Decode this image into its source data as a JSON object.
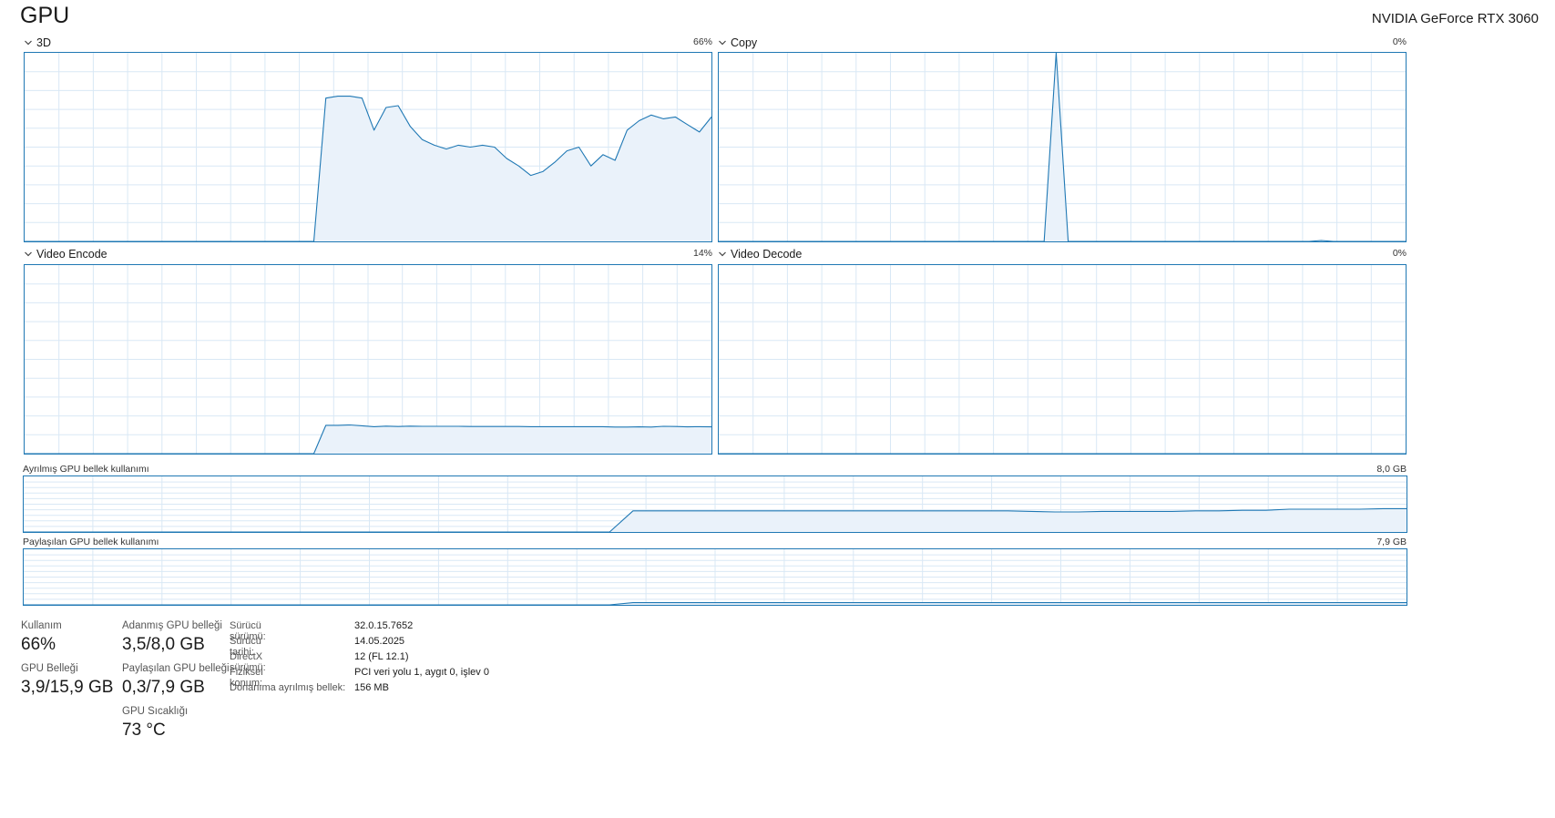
{
  "header": {
    "title": "GPU",
    "device_name": "NVIDIA GeForce RTX 3060"
  },
  "engines": [
    {
      "label": "3D",
      "max_label": "66%",
      "values": [
        0,
        0,
        0,
        0,
        0,
        0,
        0,
        0,
        0,
        0,
        0,
        0,
        0,
        0,
        0,
        0,
        0,
        0,
        0,
        0,
        0,
        0,
        0,
        0,
        0,
        76,
        77,
        77,
        76,
        59,
        71,
        72,
        61,
        54,
        51,
        49,
        51,
        50,
        51,
        50,
        44,
        40,
        35,
        37,
        42,
        48,
        50,
        40,
        46,
        43,
        59,
        64,
        67,
        65,
        66,
        62,
        58,
        66
      ],
      "color": "#1f78b4"
    },
    {
      "label": "Copy",
      "max_label": "0%",
      "values": [
        0,
        0,
        0,
        0,
        0,
        0,
        0,
        0,
        0,
        0,
        0,
        0,
        0,
        0,
        0,
        0,
        0,
        0,
        0,
        0,
        0,
        0,
        0,
        0,
        0,
        0,
        0,
        0,
        100,
        0,
        0,
        0,
        0,
        0,
        0,
        0,
        0,
        0,
        0,
        0,
        0,
        0,
        0,
        0,
        0,
        0,
        0,
        0,
        0,
        0,
        0.5,
        0,
        0,
        0,
        0,
        0,
        0,
        0
      ]
    },
    {
      "label": "Video Encode",
      "max_label": "14%",
      "values": [
        0,
        0,
        0,
        0,
        0,
        0,
        0,
        0,
        0,
        0,
        0,
        0,
        0,
        0,
        0,
        0,
        0,
        0,
        0,
        0,
        0,
        0,
        0,
        0,
        0,
        15,
        15,
        15.2,
        14.8,
        14.3,
        14.6,
        14.4,
        14.6,
        14.5,
        14.5,
        14.5,
        14.5,
        14.4,
        14.4,
        14.4,
        14.4,
        14.4,
        14.3,
        14.3,
        14.3,
        14.3,
        14.3,
        14.3,
        14.3,
        14.1,
        14.1,
        14.2,
        14.1,
        14.5,
        14.4,
        14.2,
        14.3,
        14.2
      ]
    },
    {
      "label": "Video Decode",
      "max_label": "0%",
      "values": [
        0,
        0,
        0,
        0,
        0,
        0,
        0,
        0,
        0,
        0,
        0,
        0,
        0,
        0,
        0,
        0,
        0,
        0,
        0,
        0,
        0,
        0,
        0,
        0,
        0,
        0,
        0,
        0,
        0,
        0,
        0,
        0,
        0,
        0,
        0,
        0,
        0,
        0,
        0,
        0,
        0,
        0,
        0,
        0,
        0,
        0,
        0,
        0,
        0,
        0,
        0,
        0,
        0,
        0,
        0,
        0,
        0,
        0
      ]
    }
  ],
  "memory_graphs": [
    {
      "label": "Ayrılmış GPU bellek kullanımı",
      "max_label": "8,0 GB",
      "values": [
        0,
        0,
        0,
        0,
        0,
        0,
        0,
        0,
        0,
        0,
        0,
        0,
        0,
        0,
        0,
        0,
        0,
        0,
        0,
        0,
        0,
        0,
        0,
        0,
        0,
        0,
        38,
        38,
        38,
        38,
        38,
        38,
        38,
        38,
        38,
        38,
        38,
        38,
        38,
        38,
        38,
        38,
        38,
        37,
        36,
        36,
        37,
        37,
        37,
        37,
        38,
        38,
        39,
        39,
        41,
        41,
        41,
        41,
        42,
        42
      ]
    },
    {
      "label": "Paylaşılan GPU bellek kullanımı",
      "max_label": "7,9 GB",
      "values": [
        0,
        0,
        0,
        0,
        0,
        0,
        0,
        0,
        0,
        0,
        0,
        0,
        0,
        0,
        0,
        0,
        0,
        0,
        0,
        0,
        0,
        0,
        0,
        0,
        0,
        0,
        4,
        4,
        4,
        4,
        4,
        4,
        4,
        4,
        4,
        4,
        4,
        4,
        4,
        4,
        4,
        4,
        4,
        4,
        4,
        4,
        4,
        4,
        4,
        4,
        4,
        4,
        4,
        4,
        4,
        4,
        4,
        4,
        4,
        4
      ]
    }
  ],
  "stats": {
    "usage_label": "Kullanım",
    "usage_value": "66%",
    "dedicated_label": "Adanmış GPU belleği",
    "dedicated_value": "3,5/8,0 GB",
    "gpu_mem_label": "GPU Belleği",
    "gpu_mem_value": "3,9/15,9 GB",
    "shared_label": "Paylaşılan GPU belleği",
    "shared_value": "0,3/7,9 GB",
    "temp_label": "GPU Sıcaklığı",
    "temp_value": "73 °C"
  },
  "info": [
    {
      "key": "Sürücü sürümü:",
      "value": "32.0.15.7652"
    },
    {
      "key": "Sürücü tarihi:",
      "value": "14.05.2025"
    },
    {
      "key": "DirectX sürümü:",
      "value": "12 (FL 12.1)"
    },
    {
      "key": "Fiziksel konum:",
      "value": "PCI veri yolu 1, aygıt 0, işlev 0"
    },
    {
      "key": "Donanıma ayrılmış bellek:",
      "value": "156 MB"
    }
  ],
  "colors": {
    "line": "#1f78b4",
    "fill": "#eaf2fa",
    "grid": "#d9e8f5",
    "border": "#1f78b4"
  }
}
